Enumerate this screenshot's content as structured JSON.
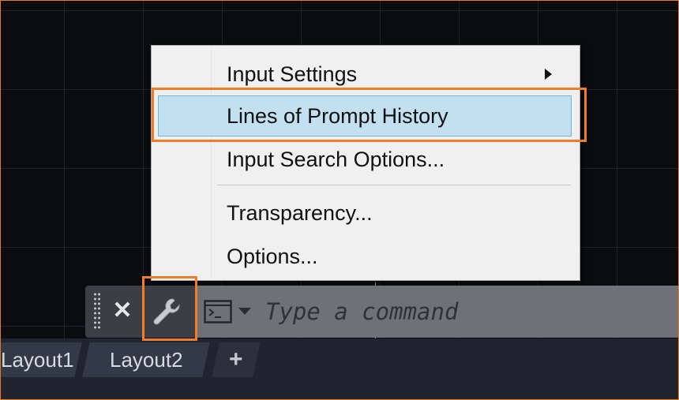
{
  "menu": {
    "items": [
      {
        "label": "Input Settings",
        "submenu": true
      },
      {
        "label": "Lines of Prompt History",
        "highlighted": true
      },
      {
        "label": "Input Search Options..."
      },
      {
        "label": "Transparency..."
      },
      {
        "label": "Options..."
      }
    ]
  },
  "command_line": {
    "placeholder": "Type a command",
    "icons": [
      "grip-handle-icon",
      "close-icon",
      "wrench-icon",
      "terminal-icon",
      "dropdown-arrow-icon"
    ]
  },
  "layout_tabs": {
    "tabs": [
      {
        "label": "Layout1"
      },
      {
        "label": "Layout2"
      }
    ],
    "add_label": "+"
  },
  "colors": {
    "highlight_fill": "#c3e0f0",
    "highlight_border": "#6ab4de",
    "annotation_orange": "#f07d2a",
    "menu_background": "#f0f0f0",
    "command_input_bg": "#6e7278",
    "tab_bar_bg": "#1f2430"
  }
}
